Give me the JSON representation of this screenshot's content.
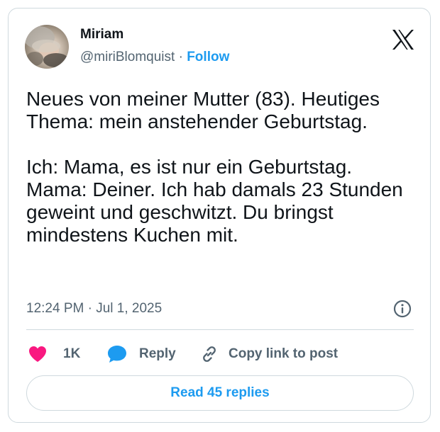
{
  "author": {
    "name": "Miriam",
    "handle": "@miriBlomquist",
    "separator": "·",
    "follow_label": "Follow"
  },
  "tweet": {
    "paragraphs": [
      "Neues von meiner Mutter (83). Heutiges Thema: mein anstehender Geburtstag.",
      "Ich: Mama, es ist nur ein Geburtstag. Mama: Deiner. Ich hab damals 23 Stunden geweint und geschwitzt. Du bringst mindestens Kuchen mit."
    ],
    "timestamp": "12:24 PM · Jul 1, 2025"
  },
  "actions": {
    "like_count": "1K",
    "reply_label": "Reply",
    "copy_label": "Copy link to post"
  },
  "footer": {
    "read_replies_label": "Read 45 replies"
  },
  "icons": {
    "logo": "x-logo-icon",
    "info": "info-icon",
    "like": "heart-icon",
    "reply": "speech-bubble-icon",
    "copy": "link-icon"
  },
  "colors": {
    "accent": "#1d9bf0",
    "like": "#f91880",
    "text": "#0f1419",
    "secondary": "#536471",
    "border": "#cfd9de"
  }
}
